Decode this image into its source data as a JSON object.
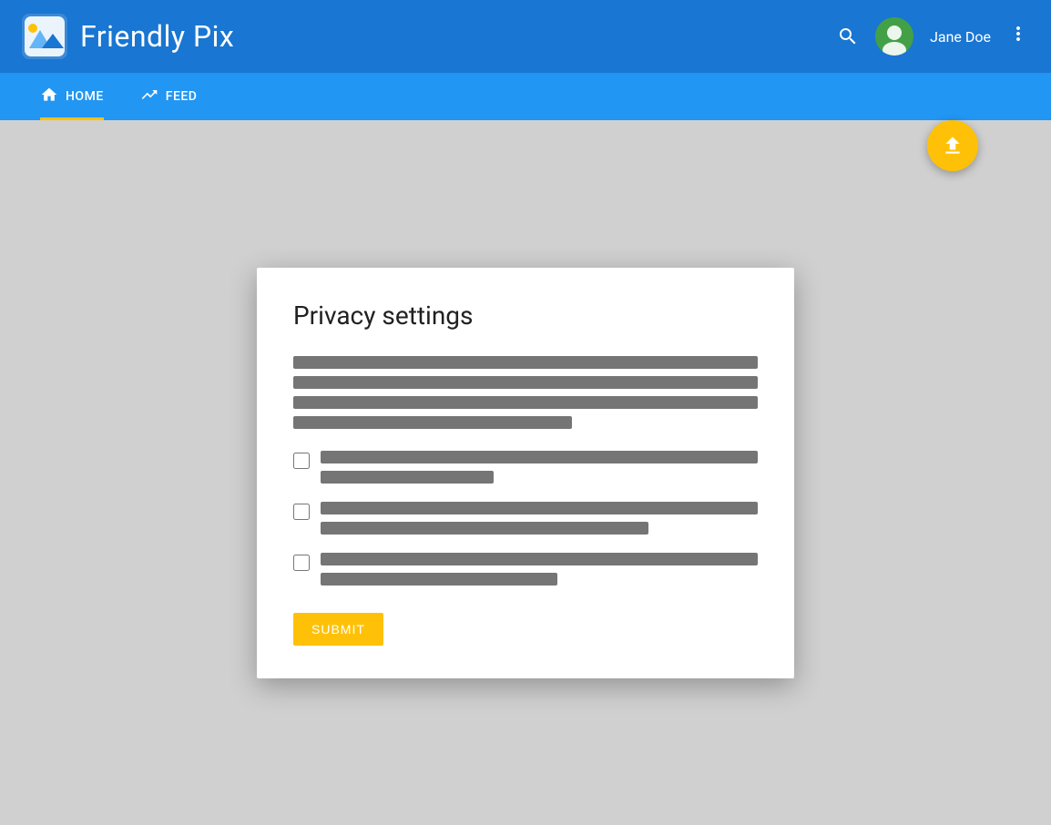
{
  "app": {
    "name": "Friendly Pix",
    "brand_color": "#1976D2",
    "accent_color": "#FFC107"
  },
  "header": {
    "search_icon": "search",
    "user_name": "Jane Doe",
    "user_avatar_color": "#43A047",
    "more_icon": "more_vert"
  },
  "nav": {
    "items": [
      {
        "id": "home",
        "label": "HOME",
        "icon": "home",
        "active": true
      },
      {
        "id": "feed",
        "label": "FEED",
        "icon": "trending_up",
        "active": false
      }
    ]
  },
  "fab": {
    "icon": "upload",
    "tooltip": "Upload photo"
  },
  "dialog": {
    "title": "Privacy settings",
    "description_lines": [
      {
        "width": "100%"
      },
      {
        "width": "100%"
      },
      {
        "width": "100%"
      },
      {
        "width": "60%"
      }
    ],
    "checkboxes": [
      {
        "id": "cb1",
        "checked": false,
        "line1_width": "100%",
        "line2_width": "40%"
      },
      {
        "id": "cb2",
        "checked": false,
        "line1_width": "100%",
        "line2_width": "72%"
      },
      {
        "id": "cb3",
        "checked": false,
        "line1_width": "100%",
        "line2_width": "48%"
      }
    ],
    "submit_label": "SUBMIT"
  }
}
